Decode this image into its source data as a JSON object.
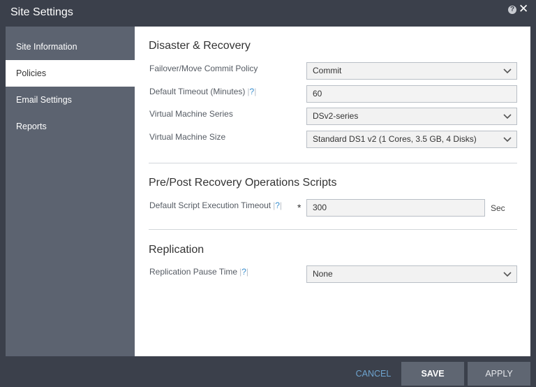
{
  "window": {
    "title": "Site Settings",
    "help_glyph": "?",
    "close_glyph": "✕"
  },
  "sidebar": {
    "items": [
      {
        "label": "Site Information",
        "active": false
      },
      {
        "label": "Policies",
        "active": true
      },
      {
        "label": "Email Settings",
        "active": false
      },
      {
        "label": "Reports",
        "active": false
      }
    ]
  },
  "disaster_recovery": {
    "title": "Disaster & Recovery",
    "failover_label": "Failover/Move Commit Policy",
    "failover_value": "Commit",
    "timeout_label": "Default Timeout (Minutes)",
    "timeout_value": "60",
    "vm_series_label": "Virtual Machine Series",
    "vm_series_value": "DSv2-series",
    "vm_size_label": "Virtual Machine Size",
    "vm_size_value": "Standard DS1 v2 (1 Cores, 3.5 GB, 4 Disks)"
  },
  "scripts": {
    "title": "Pre/Post Recovery Operations Scripts",
    "timeout_label": "Default Script Execution Timeout",
    "required_mark": "*",
    "timeout_value": "300",
    "unit": "Sec"
  },
  "replication": {
    "title": "Replication",
    "pause_label": "Replication Pause Time",
    "pause_value": "None"
  },
  "help_link": {
    "bar": "|",
    "text": "?"
  },
  "footer": {
    "cancel": "CANCEL",
    "save": "SAVE",
    "apply": "APPLY"
  },
  "colors": {
    "accent": "#3a8fcf",
    "chrome": "#3b404b",
    "sidebar": "#5c6370",
    "button": "#5f6672"
  }
}
